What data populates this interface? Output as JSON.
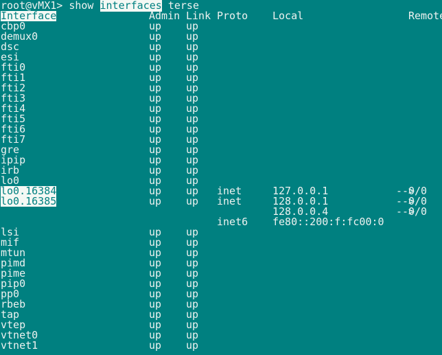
{
  "prompt": {
    "host": "root@vMX1> ",
    "cmd1": "show ",
    "cmd2": "interfaces",
    "cmd3": " terse"
  },
  "headers": {
    "interface": "Interface",
    "admin": "Admin",
    "link": "Link",
    "proto": "Proto",
    "local": "Local",
    "remote": "Remote"
  },
  "rows": [
    {
      "name": "cbp0",
      "admin": "up",
      "link": "up"
    },
    {
      "name": "demux0",
      "admin": "up",
      "link": "up"
    },
    {
      "name": "dsc",
      "admin": "up",
      "link": "up"
    },
    {
      "name": "esi",
      "admin": "up",
      "link": "up"
    },
    {
      "name": "fti0",
      "admin": "up",
      "link": "up"
    },
    {
      "name": "fti1",
      "admin": "up",
      "link": "up"
    },
    {
      "name": "fti2",
      "admin": "up",
      "link": "up"
    },
    {
      "name": "fti3",
      "admin": "up",
      "link": "up"
    },
    {
      "name": "fti4",
      "admin": "up",
      "link": "up"
    },
    {
      "name": "fti5",
      "admin": "up",
      "link": "up"
    },
    {
      "name": "fti6",
      "admin": "up",
      "link": "up"
    },
    {
      "name": "fti7",
      "admin": "up",
      "link": "up"
    },
    {
      "name": "gre",
      "admin": "up",
      "link": "up"
    },
    {
      "name": "ipip",
      "admin": "up",
      "link": "up"
    },
    {
      "name": "irb",
      "admin": "up",
      "link": "up"
    },
    {
      "name": "lo0",
      "admin": "up",
      "link": "up"
    },
    {
      "name": "lo0.16384",
      "admin": "up",
      "link": "up",
      "proto": "inet",
      "local": "127.0.0.1",
      "arrow": "-->",
      "remote": "0/0",
      "highlight": true
    },
    {
      "name": "lo0.16385",
      "admin": "up",
      "link": "up",
      "proto": "inet",
      "local": "128.0.0.1",
      "arrow": "-->",
      "remote": "0/0",
      "highlight": true
    },
    {
      "local": "128.0.0.4",
      "arrow": "-->",
      "remote": "0/0"
    },
    {
      "proto": "inet6",
      "local": "fe80::200:f:fc00:0"
    },
    {
      "name": "lsi",
      "admin": "up",
      "link": "up"
    },
    {
      "name": "mif",
      "admin": "up",
      "link": "up"
    },
    {
      "name": "mtun",
      "admin": "up",
      "link": "up"
    },
    {
      "name": "pimd",
      "admin": "up",
      "link": "up"
    },
    {
      "name": "pime",
      "admin": "up",
      "link": "up"
    },
    {
      "name": "pip0",
      "admin": "up",
      "link": "up"
    },
    {
      "name": "pp0",
      "admin": "up",
      "link": "up"
    },
    {
      "name": "rbeb",
      "admin": "up",
      "link": "up"
    },
    {
      "name": "tap",
      "admin": "up",
      "link": "up"
    },
    {
      "name": "vtep",
      "admin": "up",
      "link": "up"
    },
    {
      "name": "vtnet0",
      "admin": "up",
      "link": "up"
    },
    {
      "name": "vtnet1",
      "admin": "up",
      "link": "up"
    }
  ]
}
